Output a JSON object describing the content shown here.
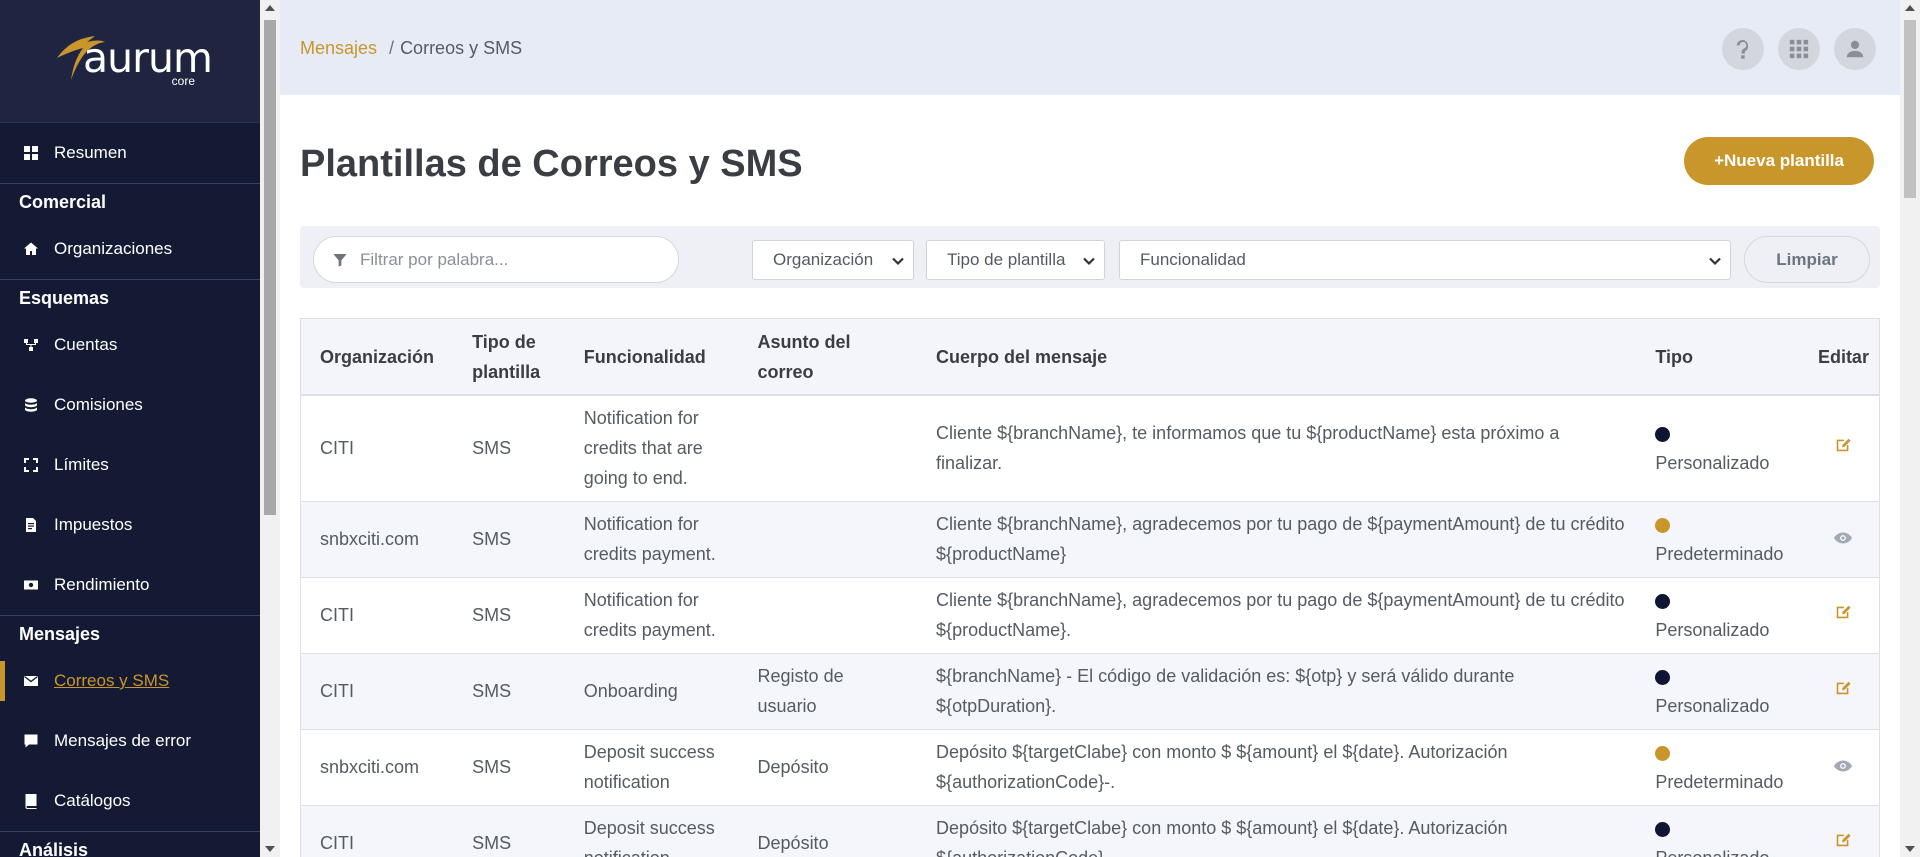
{
  "brand": {
    "name": "aurum",
    "sub": "core"
  },
  "colors": {
    "accent": "#c9962b",
    "sidebar_bg": "#141a33",
    "custom_dot": "#0f1633",
    "default_dot": "#c9962b"
  },
  "sidebar": {
    "items": [
      {
        "type": "item",
        "label": "Resumen",
        "icon": "dashboard-icon"
      },
      {
        "type": "section",
        "label": "Comercial"
      },
      {
        "type": "item",
        "label": "Organizaciones",
        "icon": "home-icon"
      },
      {
        "type": "section",
        "label": "Esquemas"
      },
      {
        "type": "item",
        "label": "Cuentas",
        "icon": "network-icon"
      },
      {
        "type": "item",
        "label": "Comisiones",
        "icon": "coins-icon"
      },
      {
        "type": "item",
        "label": "Límites",
        "icon": "expand-icon"
      },
      {
        "type": "item",
        "label": "Impuestos",
        "icon": "file-invoice-icon"
      },
      {
        "type": "item",
        "label": "Rendimiento",
        "icon": "money-bill-icon"
      },
      {
        "type": "section",
        "label": "Mensajes"
      },
      {
        "type": "item",
        "label": "Correos y SMS",
        "icon": "envelope-icon",
        "active": true
      },
      {
        "type": "item",
        "label": "Mensajes de error",
        "icon": "comment-icon"
      },
      {
        "type": "item",
        "label": "Catálogos",
        "icon": "book-icon"
      },
      {
        "type": "section",
        "label": "Análisis"
      }
    ]
  },
  "breadcrumb": {
    "parent": "Mensajes",
    "separator": "/",
    "current": "Correos y SMS"
  },
  "header": {
    "title": "Plantillas de Correos y SMS",
    "new_button": "+Nueva plantilla"
  },
  "filters": {
    "search_placeholder": "Filtrar por palabra...",
    "organization": "Organización",
    "template_type": "Tipo de plantilla",
    "functionality": "Funcionalidad",
    "clear": "Limpiar"
  },
  "table": {
    "headers": [
      "Organización",
      "Tipo de plantilla",
      "Funcionalidad",
      "Asunto del correo",
      "Cuerpo del mensaje",
      "Tipo",
      "Editar"
    ],
    "rows": [
      {
        "org": "CITI",
        "type": "SMS",
        "func": "Notification for credits that are going to end.",
        "subject": "",
        "body": "Cliente ${branchName}, te informamos que tu ${productName} esta próximo a finalizar.",
        "kind": "Personalizado",
        "kind_code": "custom",
        "action": "edit"
      },
      {
        "org": "snbxciti.com",
        "type": "SMS",
        "func": "Notification for credits payment.",
        "subject": "",
        "body": "Cliente ${branchName}, agradecemos por tu pago de ${paymentAmount} de tu crédito ${productName}",
        "kind": "Predeterminado",
        "kind_code": "default",
        "action": "view"
      },
      {
        "org": "CITI",
        "type": "SMS",
        "func": "Notification for credits payment.",
        "subject": "",
        "body": "Cliente ${branchName}, agradecemos por tu pago de ${paymentAmount} de tu crédito ${productName}.",
        "kind": "Personalizado",
        "kind_code": "custom",
        "action": "edit"
      },
      {
        "org": "CITI",
        "type": "SMS",
        "func": "Onboarding",
        "subject": "Registo de usuario",
        "body": "${branchName} - El código de validación es: ${otp} y será válido durante ${otpDuration}.",
        "kind": "Personalizado",
        "kind_code": "custom",
        "action": "edit"
      },
      {
        "org": "snbxciti.com",
        "type": "SMS",
        "func": "Deposit success notification",
        "subject": "Depósito",
        "body": "Depósito ${targetClabe} con monto $ ${amount} el ${date}. Autorización ${authorizationCode}-.",
        "kind": "Predeterminado",
        "kind_code": "default",
        "action": "view"
      },
      {
        "org": "CITI",
        "type": "SMS",
        "func": "Deposit success notification",
        "subject": "Depósito",
        "body": "Depósito ${targetClabe} con monto $ ${amount} el ${date}. Autorización ${authorizationCode}-.",
        "kind": "Personalizado",
        "kind_code": "custom",
        "action": "edit"
      }
    ]
  }
}
